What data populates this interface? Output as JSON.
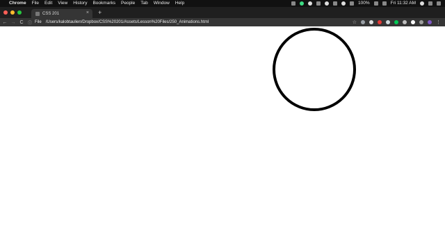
{
  "menubar": {
    "app": "Chrome",
    "items": [
      "File",
      "Edit",
      "View",
      "History",
      "Bookmarks",
      "People",
      "Tab",
      "Window",
      "Help"
    ],
    "battery": "100%",
    "clock": "Fri 11:32 AM"
  },
  "tab": {
    "title": "CSS 201",
    "close": "×"
  },
  "newtab_label": "+",
  "toolbar": {
    "back": "←",
    "forward": "→",
    "reload": "C",
    "scheme": "File",
    "url": "/Users/kalobtaulien/Dropbox/CSS%20201/Assets/Lesson%20Files/250_Animations.html",
    "star": "☆",
    "menu": "⋮"
  },
  "icons": {
    "apple": "apple-icon",
    "tab_favicon": "file-icon"
  },
  "colors": {
    "page_background": "#ffffff",
    "circle_border": "#000000",
    "chrome_dark": "#353535"
  }
}
